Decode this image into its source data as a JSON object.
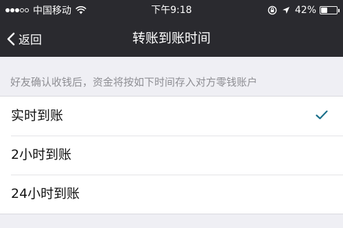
{
  "status_bar": {
    "signal_bars": 5,
    "signal_bars_active": 3,
    "carrier": "中国移动",
    "time": "下午9:18",
    "battery_text": "42%",
    "battery_level": 0.42,
    "icons": [
      "wifi-icon",
      "rotation-lock-icon",
      "location-arrow-icon",
      "battery-icon"
    ]
  },
  "nav": {
    "back_label": "返回",
    "title": "转账到账时间"
  },
  "section_hint": "好友确认收钱后，资金将按如下时间存入对方零钱账户",
  "options": [
    {
      "label": "实时到账",
      "selected": true
    },
    {
      "label": "2小时到账",
      "selected": false
    },
    {
      "label": "24小时到账",
      "selected": false
    }
  ],
  "colors": {
    "topbar_bg": "#2a2a2f",
    "page_bg": "#efeff4",
    "hint_text": "#8e8e93",
    "check": "#1a6f8a"
  }
}
